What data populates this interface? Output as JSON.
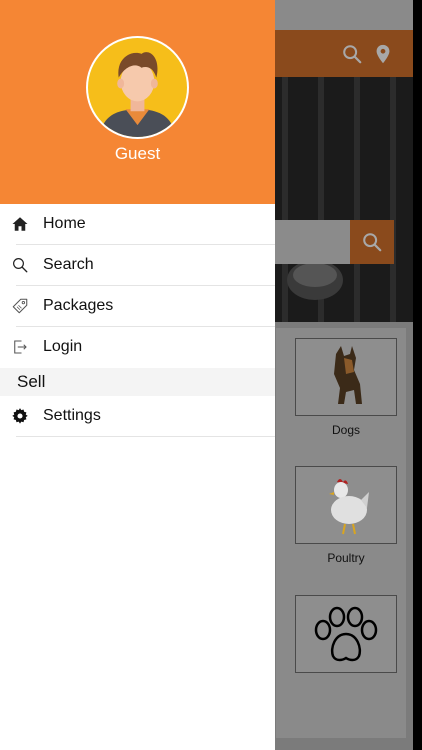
{
  "drawer": {
    "user_name": "Guest",
    "accent_color": "#f58634",
    "menu_items": [
      {
        "label": "Home",
        "icon": "home-icon"
      },
      {
        "label": "Search",
        "icon": "search-icon"
      },
      {
        "label": "Packages",
        "icon": "tag-icon"
      },
      {
        "label": "Login",
        "icon": "login-icon"
      }
    ],
    "section_title": "Sell",
    "settings_label": "Settings",
    "settings_icon": "gear-icon"
  },
  "background": {
    "categories": [
      {
        "label": "Dogs",
        "icon": "dog-image"
      },
      {
        "label": "Poultry",
        "icon": "chicken-image"
      },
      {
        "label": "",
        "icon": "paw-icon"
      }
    ]
  }
}
